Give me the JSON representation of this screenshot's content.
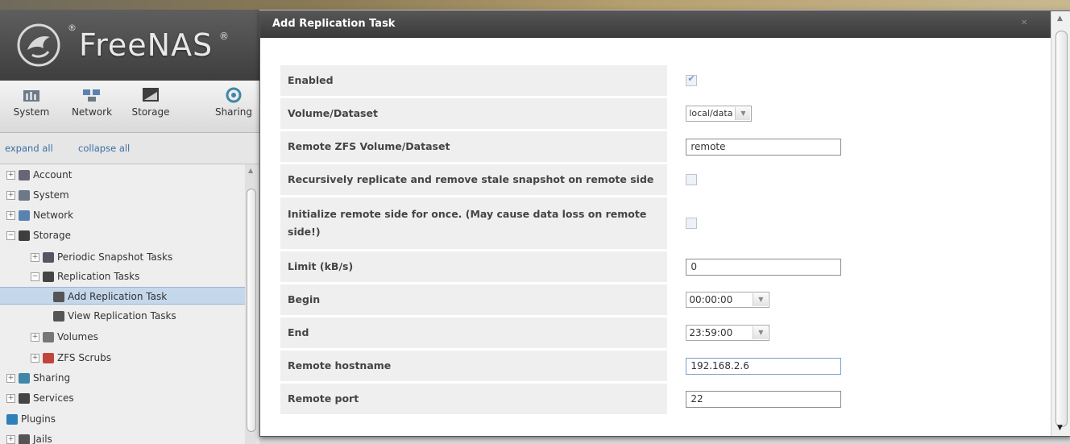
{
  "brand": {
    "name": "FreeNAS",
    "reg": "®"
  },
  "topnav": [
    {
      "label": "System",
      "icon": "system-icon"
    },
    {
      "label": "Network",
      "icon": "network-icon"
    },
    {
      "label": "Storage",
      "icon": "storage-icon"
    },
    {
      "label": "Sharing",
      "icon": "sharing-icon"
    }
  ],
  "tree_links": {
    "expand_all": "expand all",
    "collapse_all": "collapse all"
  },
  "tree": [
    {
      "label": "Account",
      "icon": "account-icon",
      "expander": "+"
    },
    {
      "label": "System",
      "icon": "system-icon",
      "expander": "+"
    },
    {
      "label": "Network",
      "icon": "network-icon",
      "expander": "+"
    },
    {
      "label": "Storage",
      "icon": "storage-icon",
      "expander": "−"
    },
    {
      "label": "Periodic Snapshot Tasks",
      "icon": "snapshot-icon",
      "expander": "+"
    },
    {
      "label": "Replication Tasks",
      "icon": "replication-icon",
      "expander": "−"
    },
    {
      "label": "Add Replication Task",
      "icon": "add-replication-icon",
      "selected": true
    },
    {
      "label": "View Replication Tasks",
      "icon": "view-replication-icon"
    },
    {
      "label": "Volumes",
      "icon": "volumes-icon",
      "expander": "+"
    },
    {
      "label": "ZFS Scrubs",
      "icon": "scrub-icon",
      "expander": "+"
    },
    {
      "label": "Sharing",
      "icon": "sharing-icon",
      "expander": "+"
    },
    {
      "label": "Services",
      "icon": "services-icon",
      "expander": "+"
    },
    {
      "label": "Plugins",
      "icon": "plugins-icon"
    },
    {
      "label": "Jails",
      "icon": "jails-icon",
      "expander": "+"
    }
  ],
  "dialog": {
    "title": "Add Replication Task",
    "fields": [
      {
        "label": "Enabled",
        "type": "checkbox",
        "checked": true
      },
      {
        "label": "Volume/Dataset",
        "type": "select",
        "value": "local/data"
      },
      {
        "label": "Remote ZFS Volume/Dataset",
        "type": "text",
        "value": "remote"
      },
      {
        "label": "Recursively replicate and remove stale snapshot on remote side",
        "type": "checkbox",
        "checked": false
      },
      {
        "label": "Initialize remote side for once. (May cause data loss on remote side!)",
        "type": "checkbox",
        "checked": false
      },
      {
        "label": "Limit (kB/s)",
        "type": "text",
        "value": "0"
      },
      {
        "label": "Begin",
        "type": "select",
        "value": "00:00:00"
      },
      {
        "label": "End",
        "type": "select",
        "value": "23:59:00"
      },
      {
        "label": "Remote hostname",
        "type": "text",
        "value": "192.168.2.6",
        "focused": true
      },
      {
        "label": "Remote port",
        "type": "text",
        "value": "22"
      }
    ]
  }
}
